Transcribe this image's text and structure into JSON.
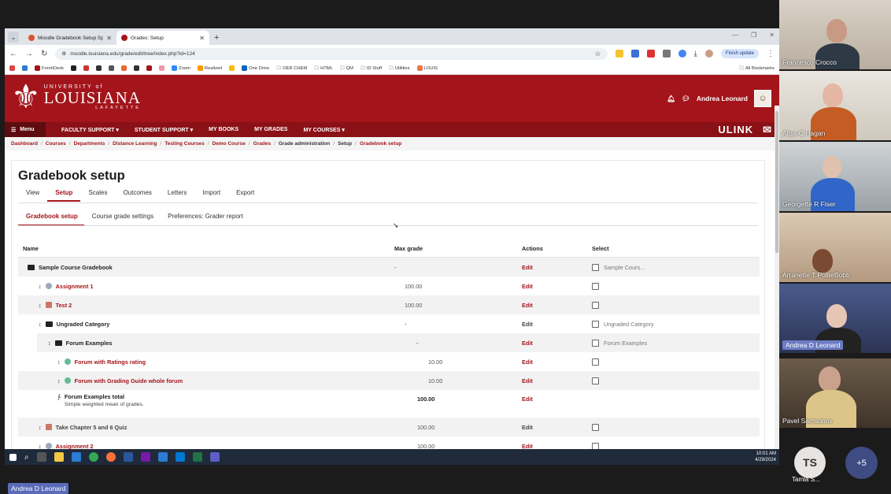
{
  "browser": {
    "tabs": [
      {
        "title": "Moodle Gradebook Setup Sp..."
      },
      {
        "title": "Grades: Setup"
      }
    ],
    "url": "moodle.louisiana.edu/grade/edit/tree/index.php?id=124",
    "finish_update": "Finish update",
    "bookmarks": [
      "FreshDesk",
      "Zoom",
      "Realizeit",
      "One Drive",
      "OER CHEM",
      "HTML",
      "QM",
      "ID Stuff",
      "Utilities",
      "LOUIS"
    ],
    "all_bookmarks": "All Bookmarks"
  },
  "site": {
    "logo_line1": "UNIVERSITY of",
    "logo_line2": "LOUISIANA",
    "logo_line3": "LAFAYETTE",
    "user_name": "Andrea Leonard",
    "menu_label": "Menu",
    "nav": [
      "FACULTY SUPPORT ▾",
      "STUDENT SUPPORT ▾",
      "MY BOOKS",
      "MY GRADES",
      "MY COURSES ▾"
    ],
    "ulink": "ULINK"
  },
  "breadcrumb": [
    "Dashboard",
    "Courses",
    "Departments",
    "Distance Learning",
    "Testing Courses",
    "Demo Course",
    "Grades",
    "Grade administration",
    "Setup",
    "Gradebook setup"
  ],
  "page": {
    "title": "Gradebook setup",
    "tabs": [
      "View",
      "Setup",
      "Scales",
      "Outcomes",
      "Letters",
      "Import",
      "Export"
    ],
    "subtabs": [
      "Gradebook setup",
      "Course grade settings",
      "Preferences: Grader report"
    ]
  },
  "table": {
    "headers": {
      "name": "Name",
      "max": "Max grade",
      "actions": "Actions",
      "select": "Select"
    },
    "rows": [
      {
        "name": "Sample Course Gradebook",
        "max": "-",
        "action": "Edit",
        "select": "Sample Cours..."
      },
      {
        "name": "Assignment 1",
        "max": "100.00",
        "action": "Edit",
        "select": ""
      },
      {
        "name": "Test 2",
        "max": "100.00",
        "action": "Edit",
        "select": ""
      },
      {
        "name": "Ungraded Category",
        "max": "-",
        "action": "Edit",
        "select": "Ungraded Category"
      },
      {
        "name": "Forum Examples",
        "max": "-",
        "action": "Edit",
        "select": "Forum Examples"
      },
      {
        "name": "Forum with Ratings rating",
        "max": "10.00",
        "action": "Edit",
        "select": ""
      },
      {
        "name": "Forum with Grading Guide whole forum",
        "max": "10.00",
        "action": "Edit",
        "select": ""
      },
      {
        "name": "Forum Examples total",
        "sub": "Simple weighted mean of grades.",
        "max": "100.00",
        "action": "Edit",
        "select": ""
      },
      {
        "name": "Take Chapter 5 and 6 Quiz",
        "max": "100.00",
        "action": "Edit",
        "select": ""
      },
      {
        "name": "Assignment 2",
        "max": "100.00",
        "action": "Edit",
        "select": ""
      }
    ]
  },
  "taskbar": {
    "time": "10:01 AM",
    "date": "4/29/2024"
  },
  "participants": [
    {
      "name": "Francesco Crocco"
    },
    {
      "name": "Alise C Hagan"
    },
    {
      "name": "Georgette R Fiser"
    },
    {
      "name": "Arranette T PoliteBobb"
    },
    {
      "name": "Andrea D Leonard"
    },
    {
      "name": "Pavel Samsonov"
    }
  ],
  "extra_participant": {
    "initials": "TS",
    "name": "Tamla S..."
  },
  "more_count": "+5",
  "presenter": "Andrea D Leonard"
}
